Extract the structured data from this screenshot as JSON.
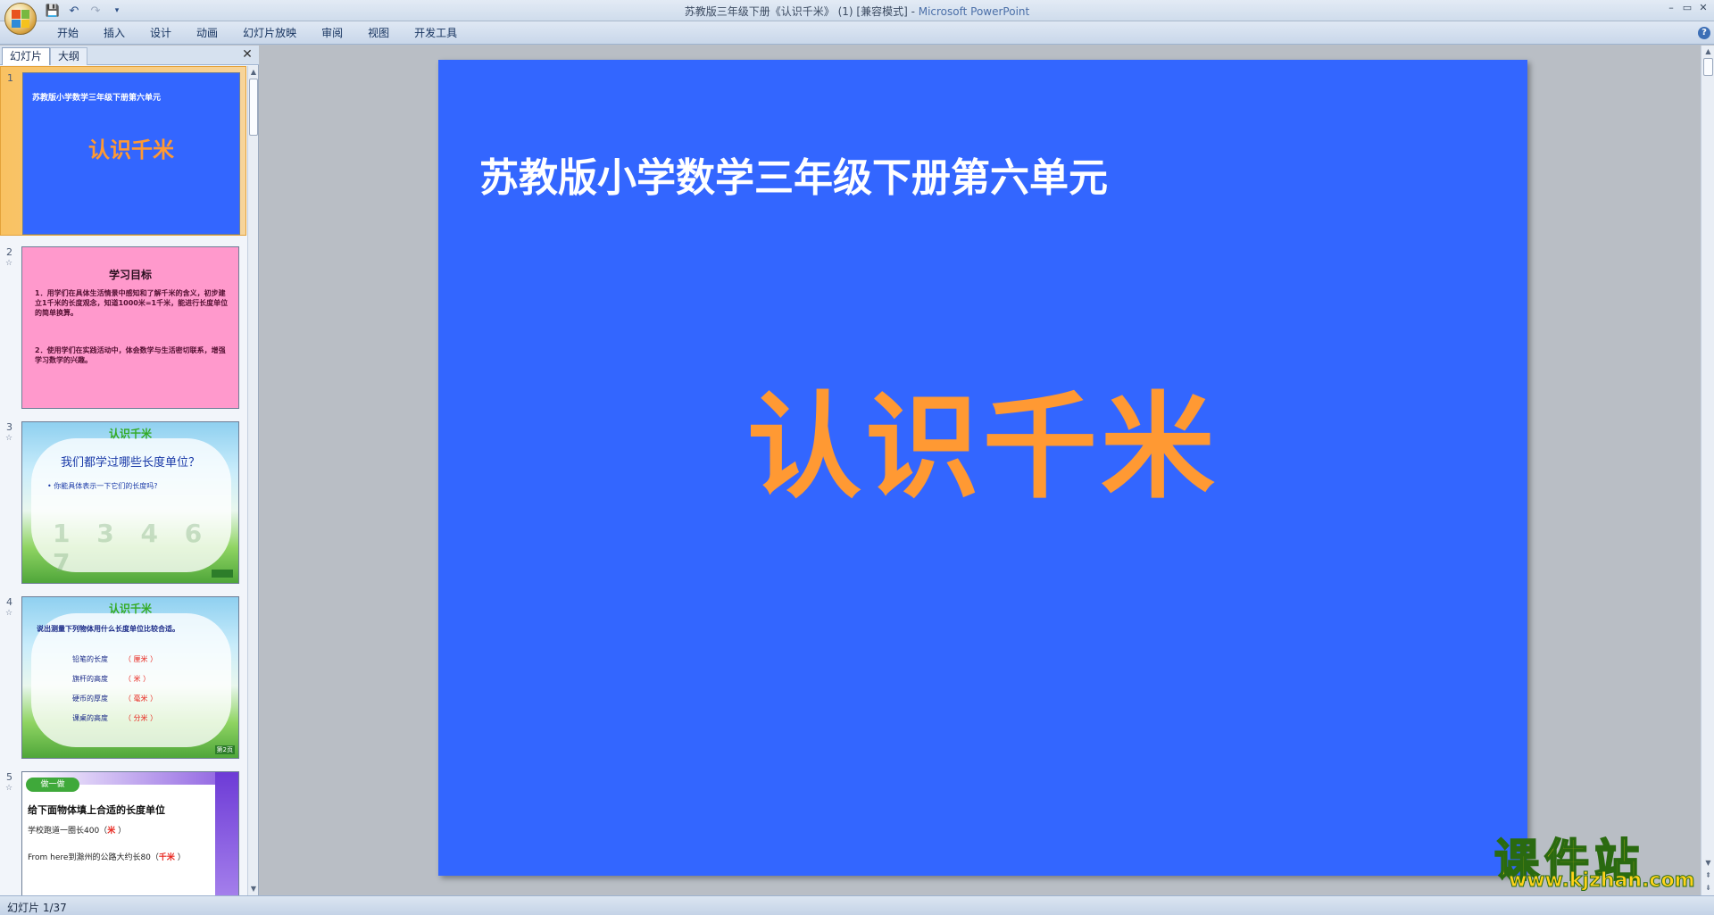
{
  "window": {
    "title": "苏教版三年级下册《认识千米》 (1) [兼容模式] - ",
    "app": "Microsoft PowerPoint",
    "controls": {
      "minimize": "–",
      "restore": "▭",
      "close": "✕"
    }
  },
  "ribbon": {
    "tabs": [
      "开始",
      "插入",
      "设计",
      "动画",
      "幻灯片放映",
      "审阅",
      "视图",
      "开发工具"
    ],
    "help": "?"
  },
  "pane": {
    "tabs": {
      "slides": "幻灯片",
      "outline": "大纲"
    },
    "close": "✕"
  },
  "thumbnails": [
    {
      "num": "1",
      "subtitle": "苏教版小学数学三年级下册第六单元",
      "title": "认识千米"
    },
    {
      "num": "2",
      "heading": "学习目标",
      "p1": "1．用学们在具体生活情景中感知和了解千米的含义，初步建立1千米的长度观念，知道1000米=1千米，能进行长度单位的简单换算。",
      "p2": "2．使用学们在实践活动中，体会数学与生活密切联系，增强学习数学的兴趣。"
    },
    {
      "num": "3",
      "heading": "认识千米",
      "question": "我们都学过哪些长度单位？",
      "bullet": "• 你能具体表示一下它们的长度吗?",
      "digits": "1 3 4 6 7"
    },
    {
      "num": "4",
      "heading": "认识千米",
      "question": "说出测量下列物体用什么长度单位比较合适。",
      "rows": [
        {
          "label": "铅笔的长度",
          "answer": "（ 厘米 ）"
        },
        {
          "label": "旗杆的高度",
          "answer": "（ 米 ）"
        },
        {
          "label": "硬币的厚度",
          "answer": "（ 毫米 ）"
        },
        {
          "label": "课桌的高度",
          "answer": "（ 分米 ）"
        }
      ],
      "corner": "第2页"
    },
    {
      "num": "5",
      "badge": "做一做",
      "heading": "给下面物体填上合适的长度单位",
      "l1": "学校跑道一圈长400（",
      "a1": "米",
      "l1end": "  ）",
      "l2": "From here到滁州的公路大约长80（",
      "a2": "千米",
      "l2end": " ）"
    }
  ],
  "slide": {
    "subtitle": "苏教版小学数学三年级下册第六单元",
    "title": "认识千米",
    "background": "#3366ff",
    "title_color": "#ff9933"
  },
  "watermark": {
    "line1": "课件站",
    "line2": "www.kjzhan.com"
  },
  "status": {
    "text": "幻灯片 1/37"
  }
}
